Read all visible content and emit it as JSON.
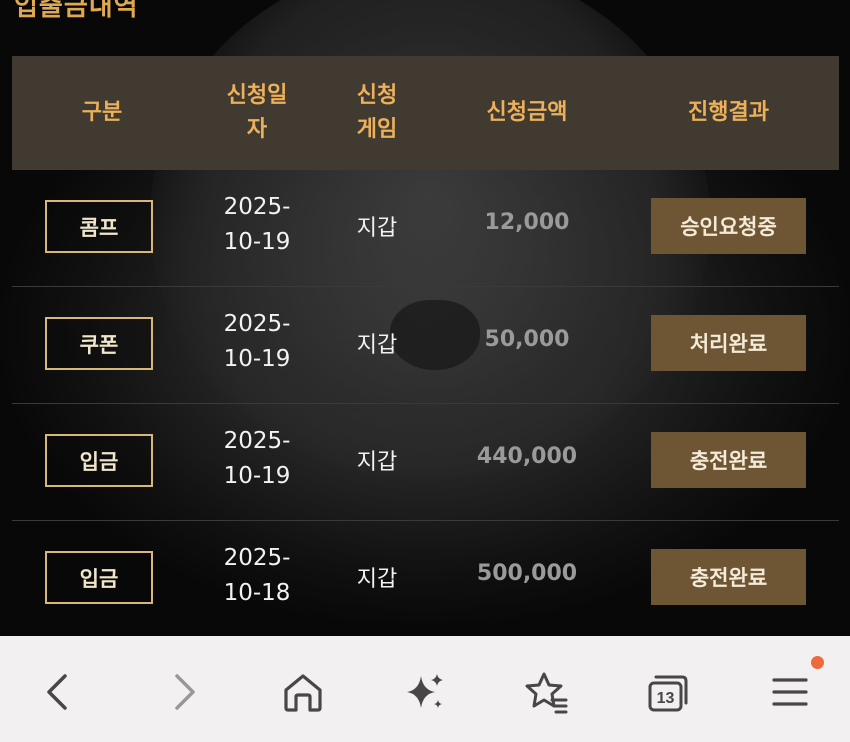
{
  "page": {
    "title": "입출금내역"
  },
  "table": {
    "headers": {
      "type": "구분",
      "date_line1": "신청일",
      "date_line2": "자",
      "game_line1": "신청",
      "game_line2": "게임",
      "amount": "신청금액",
      "result": "진행결과"
    },
    "rows": [
      {
        "type": "콤프",
        "date_line1": "2025-",
        "date_line2": "10-19",
        "game": "지갑",
        "amount": "12,000",
        "status": "승인요청중"
      },
      {
        "type": "쿠폰",
        "date_line1": "2025-",
        "date_line2": "10-19",
        "game": "지갑",
        "amount": "50,000",
        "status": "처리완료"
      },
      {
        "type": "입금",
        "date_line1": "2025-",
        "date_line2": "10-19",
        "game": "지갑",
        "amount": "440,000",
        "status": "충전완료"
      },
      {
        "type": "입금",
        "date_line1": "2025-",
        "date_line2": "10-18",
        "game": "지갑",
        "amount": "500,000",
        "status": "충전완료"
      }
    ]
  },
  "navbar": {
    "items": [
      "back-icon",
      "forward-icon",
      "home-icon",
      "sparkle-icon",
      "bookmarks-icon",
      "tabs-icon",
      "menu-icon"
    ],
    "tab_count": "13",
    "menu_notification_color": "#ee6a3b"
  },
  "colors": {
    "header_bg": "#403a30",
    "header_text": "#ecb05a",
    "status_bg": "#6e5534",
    "badge_border": "#d8b77a"
  }
}
